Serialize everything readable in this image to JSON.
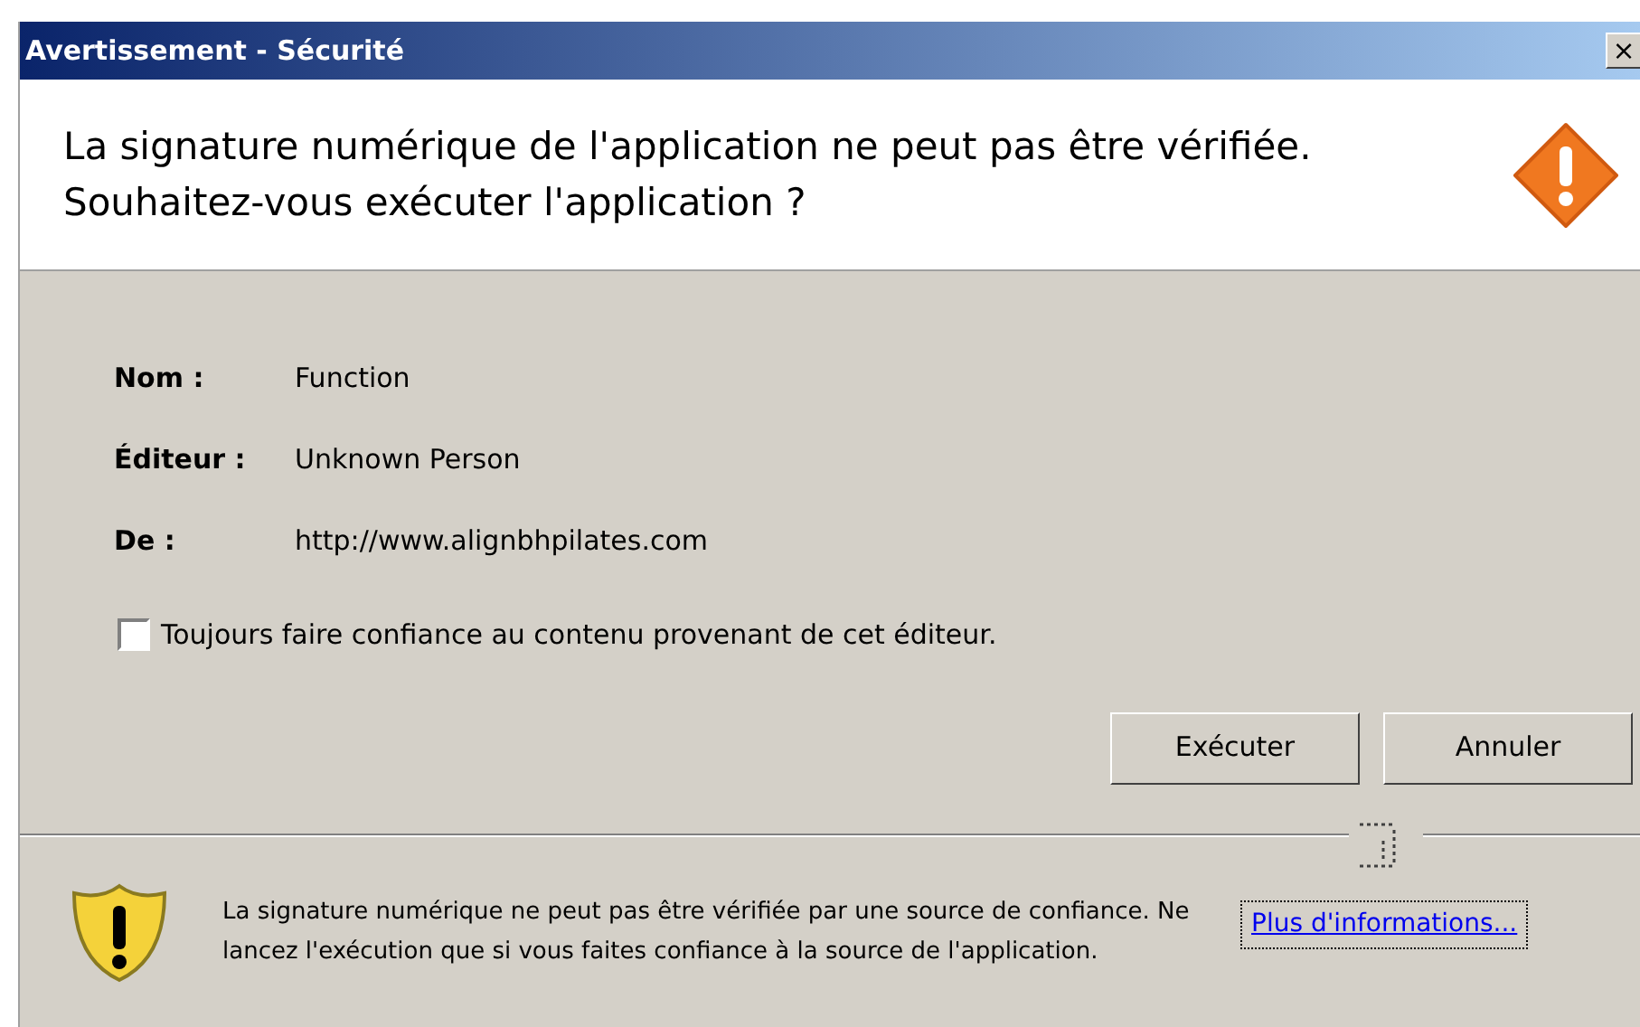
{
  "window": {
    "title": "Avertissement - Sécurité",
    "close": "×"
  },
  "header": {
    "message": "La signature numérique de l'application ne peut pas être vérifiée.  Souhaitez-vous exécuter l'application ?"
  },
  "fields": [
    {
      "label": "Nom :",
      "value": "Function"
    },
    {
      "label": "Éditeur :",
      "value": "Unknown Person"
    },
    {
      "label": "De :",
      "value": "http://www.alignbhpilates.com"
    }
  ],
  "trust_checkbox": {
    "label": "Toujours faire confiance au contenu provenant de cet éditeur.",
    "checked": false
  },
  "buttons": [
    "Exécuter",
    "Annuler"
  ],
  "footer": {
    "message": "La signature numérique ne peut pas être vérifiée par une source de confiance.  Ne lancez l'exécution que si vous faites confiance à la source de l'application.",
    "link": "Plus d'informations..."
  }
}
